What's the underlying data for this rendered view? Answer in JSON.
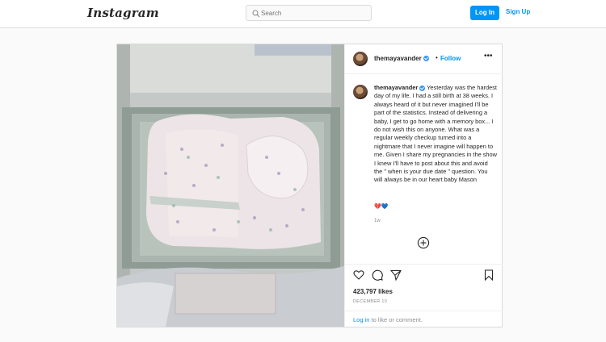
{
  "app": {
    "logo": "Instagram"
  },
  "search": {
    "placeholder": "Search"
  },
  "auth": {
    "login_label": "Log In",
    "signup_label": "Sign Up"
  },
  "post": {
    "username": "themayavander",
    "follow_label": "Follow",
    "separator": "•",
    "more_label": "•••",
    "caption": "Yesterday was the hardest day of my life. I had a still birth at 38 weeks. I always heard of it but never imagined I'll be part of the statistics. Instead of delivering a baby, I get to go home with a memory box... I do not wish this on anyone. What was a regular weekly checkup turned into a nightmare that I never imagine will happen to me. Given I share my pregnancies in the show I knew I'll have to post about this and avoid the \" when is your due date \" question. You will always be in our heart baby Mason",
    "caption_emoji": "💔💙",
    "age": "1w",
    "likes": "423,797 likes",
    "date": "DECEMBER 10",
    "comment_login": "Log in",
    "comment_rest": " to like or comment."
  },
  "colors": {
    "accent": "#0095f6",
    "verified": "#3897f0",
    "border": "#dbdbdb"
  },
  "icons": [
    "search-icon",
    "verified-badge-icon",
    "more-options-icon",
    "add-comments-icon",
    "heart-icon",
    "comment-icon",
    "share-icon",
    "bookmark-icon"
  ]
}
